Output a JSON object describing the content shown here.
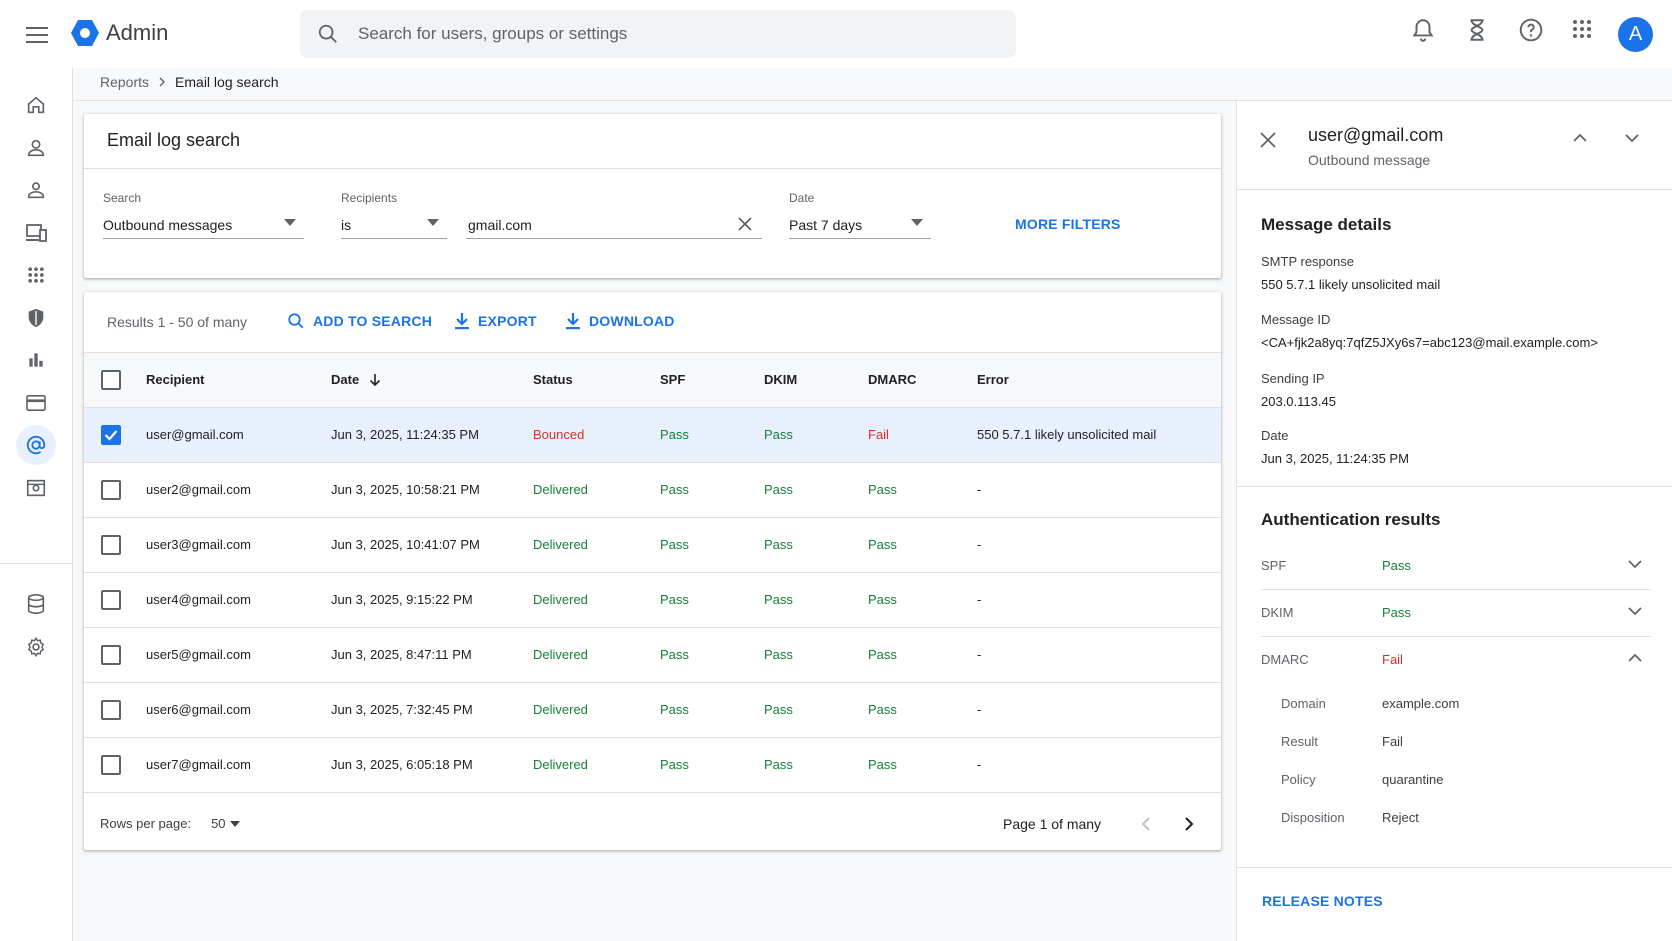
{
  "app": {
    "name": "Admin",
    "search_placeholder": "Search for users, groups or settings",
    "avatar_letter": "A",
    "accent": "#1a73e8"
  },
  "breadcrumb": {
    "parent": "Reports",
    "current": "Email log search"
  },
  "filters": {
    "title": "Email log search",
    "search_label": "Search",
    "search_value": "Outbound messages",
    "recipients_label": "Recipients",
    "recipients_operator": "is",
    "recipients_value": "gmail.com",
    "date_label": "Date",
    "date_value": "Past 7 days",
    "more_filters": "MORE FILTERS"
  },
  "results": {
    "count_text": "Results 1 - 50 of many",
    "add_to_search": "ADD TO SEARCH",
    "export": "EXPORT",
    "download": "DOWNLOAD",
    "columns": [
      "Recipient",
      "Date",
      "Status",
      "SPF",
      "DKIM",
      "DMARC",
      "Error"
    ],
    "rows": [
      {
        "recipient": "user@gmail.com",
        "date": "Jun 3, 2025, 11:24:35 PM",
        "status": "Bounced",
        "spf": "Pass",
        "dkim": "Pass",
        "dmarc": "Fail",
        "error": "550 5.7.1 likely unsolicited mail",
        "selected": true
      },
      {
        "recipient": "user2@gmail.com",
        "date": "Jun 3, 2025, 10:58:21 PM",
        "status": "Delivered",
        "spf": "Pass",
        "dkim": "Pass",
        "dmarc": "Pass",
        "error": "-",
        "selected": false
      },
      {
        "recipient": "user3@gmail.com",
        "date": "Jun 3, 2025, 10:41:07 PM",
        "status": "Delivered",
        "spf": "Pass",
        "dkim": "Pass",
        "dmarc": "Pass",
        "error": "-",
        "selected": false
      },
      {
        "recipient": "user4@gmail.com",
        "date": "Jun 3, 2025, 9:15:22 PM",
        "status": "Delivered",
        "spf": "Pass",
        "dkim": "Pass",
        "dmarc": "Pass",
        "error": "-",
        "selected": false
      },
      {
        "recipient": "user5@gmail.com",
        "date": "Jun 3, 2025, 8:47:11 PM",
        "status": "Delivered",
        "spf": "Pass",
        "dkim": "Pass",
        "dmarc": "Pass",
        "error": "-",
        "selected": false
      },
      {
        "recipient": "user6@gmail.com",
        "date": "Jun 3, 2025, 7:32:45 PM",
        "status": "Delivered",
        "spf": "Pass",
        "dkim": "Pass",
        "dmarc": "Pass",
        "error": "-",
        "selected": false
      },
      {
        "recipient": "user7@gmail.com",
        "date": "Jun 3, 2025, 6:05:18 PM",
        "status": "Delivered",
        "spf": "Pass",
        "dkim": "Pass",
        "dmarc": "Pass",
        "error": "-",
        "selected": false
      }
    ],
    "rows_per_page_label": "Rows per page:",
    "rows_per_page_value": "50",
    "page_info": "Page 1 of many"
  },
  "panel": {
    "title": "user@gmail.com",
    "subtitle": "Outbound message",
    "message_details_title": "Message details",
    "smtp_label": "SMTP response",
    "smtp_value": "550 5.7.1 likely unsolicited mail",
    "message_id_label": "Message ID",
    "message_id_value": "<CA+fjk2a8yq:7qfZ5JXy6s7=abc123@mail.example.com>",
    "sending_ip_label": "Sending IP",
    "sending_ip_value": "203.0.113.45",
    "date_label": "Date",
    "date_value": "Jun 3, 2025, 11:24:35 PM",
    "auth_title": "Authentication results",
    "auth": [
      {
        "name": "SPF",
        "value": "Pass"
      },
      {
        "name": "DKIM",
        "value": "Pass"
      },
      {
        "name": "DMARC",
        "value": "Fail"
      }
    ],
    "dmarc_details": [
      {
        "label": "Domain",
        "value": "example.com"
      },
      {
        "label": "Result",
        "value": "Fail"
      },
      {
        "label": "Policy",
        "value": "quarantine"
      },
      {
        "label": "Disposition",
        "value": "Reject"
      }
    ],
    "release_notes": "RELEASE NOTES"
  },
  "colors": {
    "pass": "#188038",
    "fail": "#d93025",
    "selected_row": "#e8f0fe"
  }
}
